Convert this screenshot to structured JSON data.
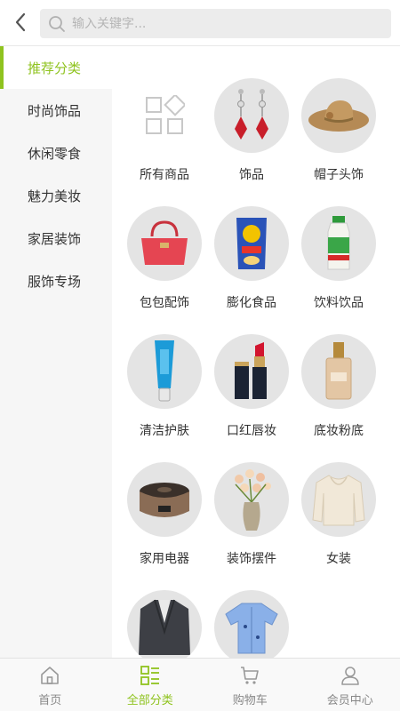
{
  "header": {
    "search_placeholder": "输入关键字..."
  },
  "sidebar": {
    "items": [
      {
        "label": "推荐分类",
        "active": true
      },
      {
        "label": "时尚饰品"
      },
      {
        "label": "休闲零食"
      },
      {
        "label": "魅力美妆"
      },
      {
        "label": "家居装饰"
      },
      {
        "label": "服饰专场"
      }
    ]
  },
  "categories": [
    {
      "label": "所有商品",
      "icon": "grid-icon"
    },
    {
      "label": "饰品",
      "icon": "earrings-icon"
    },
    {
      "label": "帽子头饰",
      "icon": "hat-icon"
    },
    {
      "label": "包包配饰",
      "icon": "handbag-icon"
    },
    {
      "label": "膨化食品",
      "icon": "chips-bag-icon"
    },
    {
      "label": "饮料饮品",
      "icon": "drink-bottle-icon"
    },
    {
      "label": "清洁护肤",
      "icon": "tube-icon"
    },
    {
      "label": "口红唇妆",
      "icon": "lipstick-icon"
    },
    {
      "label": "底妆粉底",
      "icon": "foundation-icon"
    },
    {
      "label": "家用电器",
      "icon": "rice-cooker-icon"
    },
    {
      "label": "装饰摆件",
      "icon": "flower-vase-icon"
    },
    {
      "label": "女装",
      "icon": "sweater-icon"
    },
    {
      "label": "",
      "icon": "blazer-icon"
    },
    {
      "label": "",
      "icon": "shirt-icon"
    }
  ],
  "tabbar": {
    "items": [
      {
        "label": "首页",
        "icon": "home-icon"
      },
      {
        "label": "全部分类",
        "icon": "category-icon",
        "active": true
      },
      {
        "label": "购物车",
        "icon": "cart-icon"
      },
      {
        "label": "会员中心",
        "icon": "user-icon"
      }
    ]
  },
  "colors": {
    "accent": "#8fc31f",
    "sidebar_bg": "#f6f6f6",
    "thumb_bg": "#e4e4e4"
  }
}
